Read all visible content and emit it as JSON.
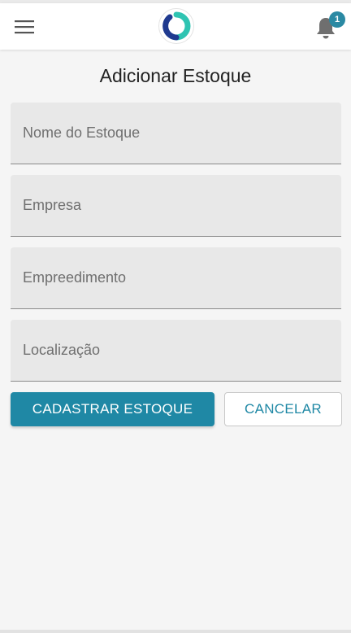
{
  "header": {
    "menu_icon": "hamburger-menu-icon",
    "logo_icon": "app-logo",
    "notifications": {
      "icon": "bell-icon",
      "count": "1"
    }
  },
  "page": {
    "title": "Adicionar Estoque"
  },
  "form": {
    "fields": [
      {
        "placeholder": "Nome do Estoque",
        "value": ""
      },
      {
        "placeholder": "Empresa",
        "value": ""
      },
      {
        "placeholder": "Empreedimento",
        "value": ""
      },
      {
        "placeholder": "Localização",
        "value": ""
      }
    ],
    "submit_label": "CADASTRAR ESTOQUE",
    "cancel_label": "CANCELAR"
  },
  "colors": {
    "primary": "#1f88a5",
    "badge": "#2a89a3",
    "field_background": "#e8e8e8",
    "page_background": "#f5f5f5",
    "logo_teal": "#2fc4b2",
    "logo_navy": "#1f3a8f"
  }
}
